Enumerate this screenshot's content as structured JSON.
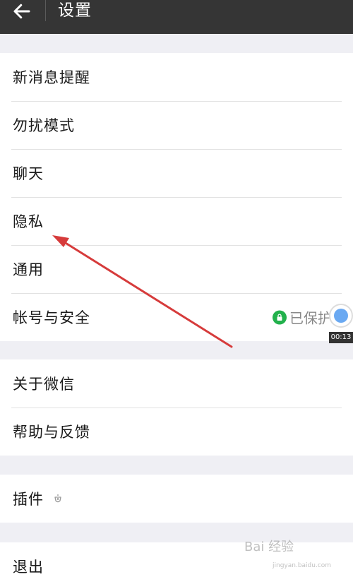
{
  "header": {
    "title": "设置"
  },
  "groups": [
    {
      "items": [
        {
          "label": "新消息提醒"
        },
        {
          "label": "勿扰模式"
        },
        {
          "label": "聊天"
        },
        {
          "label": "隐私"
        },
        {
          "label": "通用"
        },
        {
          "label": "帐号与安全",
          "status": "已保护"
        }
      ]
    },
    {
      "items": [
        {
          "label": "关于微信"
        },
        {
          "label": "帮助与反馈"
        }
      ]
    },
    {
      "items": [
        {
          "label": "插件"
        }
      ]
    },
    {
      "items": [
        {
          "label": "退出"
        }
      ]
    }
  ],
  "overlay": {
    "timer": "00:13"
  },
  "watermark": {
    "text": "Bai 经验",
    "sub": "jingyan.baidu.com"
  },
  "colors": {
    "topbar": "#353535",
    "background": "#efeff4",
    "secure": "#22b14c",
    "annotation_arrow": "#d63b3b"
  },
  "icons": {
    "back": "arrow-left-icon",
    "lock": "lock-icon",
    "plugin": "plugin-icon"
  }
}
